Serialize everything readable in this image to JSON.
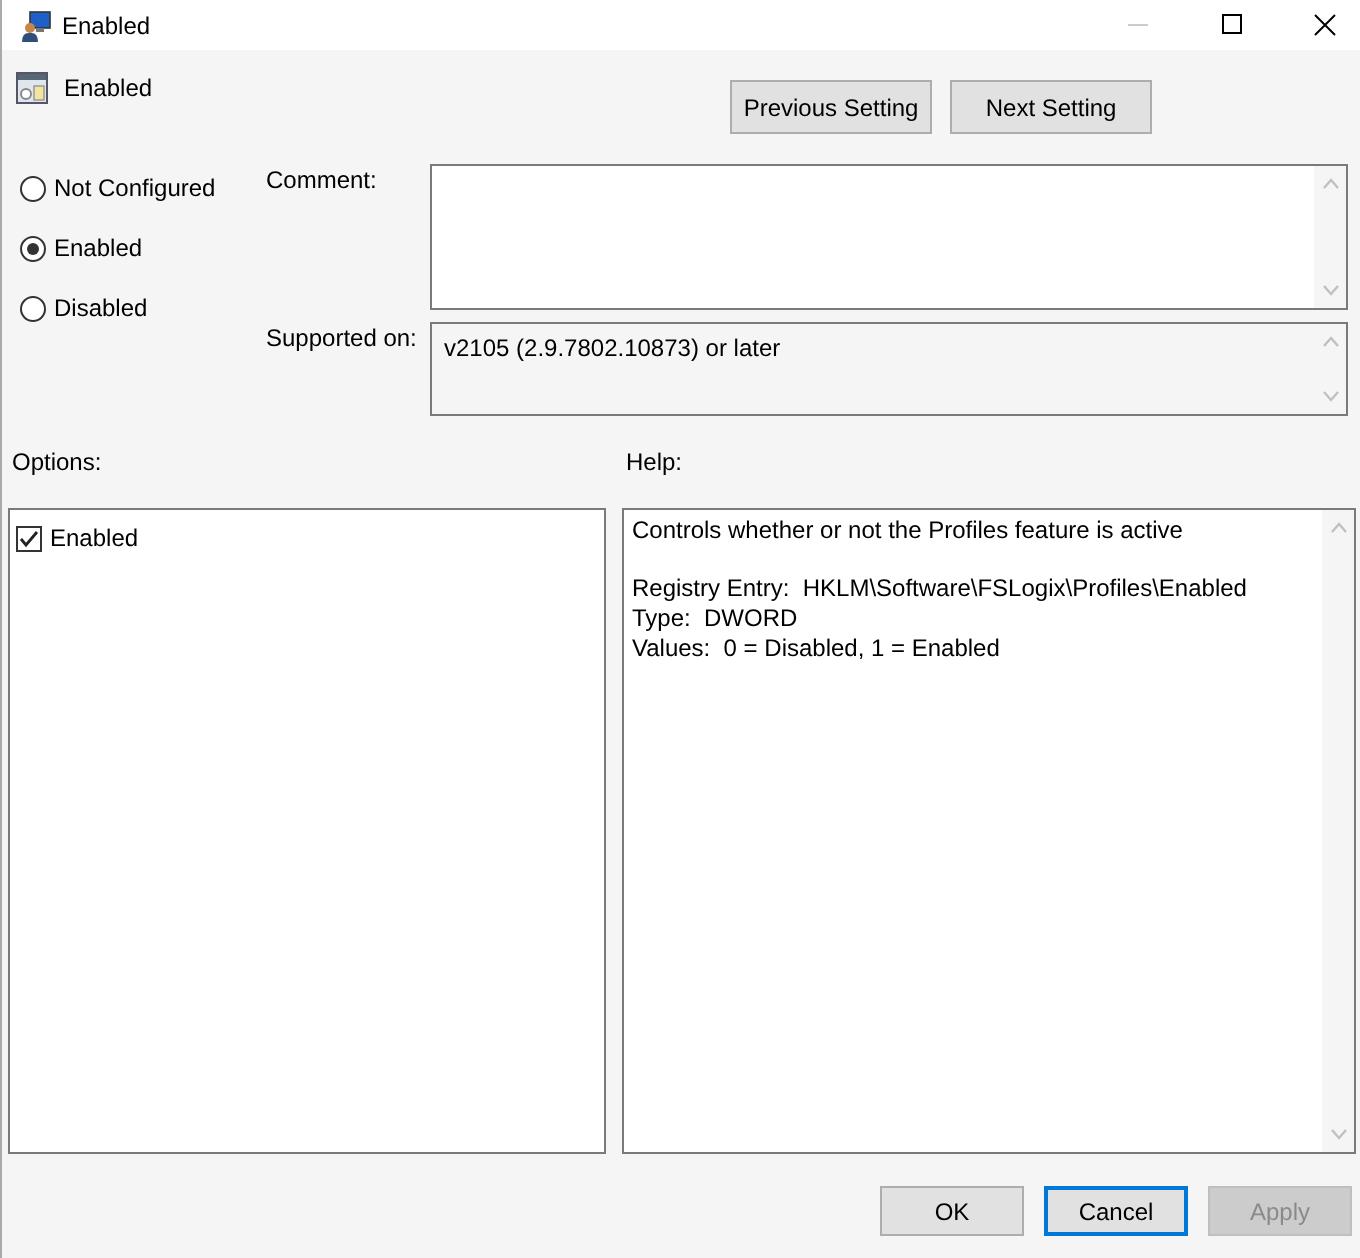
{
  "window": {
    "title": "Enabled"
  },
  "policy": {
    "name": "Enabled"
  },
  "nav_buttons": [
    {
      "label": "Previous Setting"
    },
    {
      "label": "Next Setting"
    }
  ],
  "states": [
    {
      "label": "Not Configured",
      "selected": false
    },
    {
      "label": "Enabled",
      "selected": true
    },
    {
      "label": "Disabled",
      "selected": false
    }
  ],
  "comment": {
    "label": "Comment:"
  },
  "supported_on": {
    "label": "Supported on:",
    "value": "v2105 (2.9.7802.10873) or later"
  },
  "options": {
    "label": "Options:",
    "items": [
      {
        "label": "Enabled",
        "checked": true
      }
    ]
  },
  "help": {
    "label": "Help:",
    "paragraphs": [
      [
        "Controls whether or not the Profiles feature is active"
      ],
      [
        "Registry Entry:  HKLM\\Software\\FSLogix\\Profiles\\Enabled",
        "Type:  DWORD",
        "Values:  0 = Disabled, 1 = Enabled"
      ]
    ]
  },
  "buttons": [
    {
      "label": "OK",
      "kind": "normal",
      "disabled": false
    },
    {
      "label": "Cancel",
      "kind": "default",
      "disabled": false
    },
    {
      "label": "Apply",
      "kind": "normal",
      "disabled": true
    }
  ]
}
